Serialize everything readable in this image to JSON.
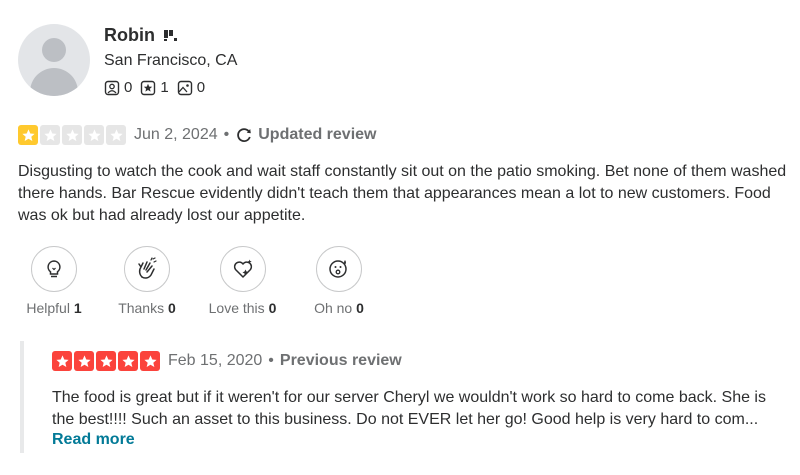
{
  "user": {
    "name": "Robin",
    "location": "San Francisco, CA",
    "stats": {
      "friends": "0",
      "reviews": "1",
      "photos": "0"
    }
  },
  "review": {
    "rating": 1,
    "date": "Jun 2, 2024",
    "status": "Updated review",
    "text": "Disgusting to watch the cook and wait staff constantly sit out on the patio smoking. Bet none of them washed there hands. Bar Rescue evidently didn't teach them that appearances mean a lot to new customers. Food was ok but had already lost our appetite.",
    "reactions": [
      {
        "label": "Helpful",
        "count": "1",
        "icon": "lightbulb-icon"
      },
      {
        "label": "Thanks",
        "count": "0",
        "icon": "clapping-hands-icon"
      },
      {
        "label": "Love this",
        "count": "0",
        "icon": "heart-sparkle-icon"
      },
      {
        "label": "Oh no",
        "count": "0",
        "icon": "surprised-face-icon"
      }
    ]
  },
  "previous_review": {
    "rating": 5,
    "date": "Feb 15, 2020",
    "label": "Previous review",
    "text": "The food is great but if it weren't for our server Cheryl we wouldn't work so hard to come back. She is the best!!!! Such an asset to this business. Do not EVER let her go! Good help is very hard to com...",
    "read_more": "Read more"
  },
  "colors": {
    "star_one": "#ffc92e",
    "star_five": "#fb433c",
    "star_empty": "#e6e6e6",
    "link": "#027a97",
    "muted": "#6e7072"
  }
}
